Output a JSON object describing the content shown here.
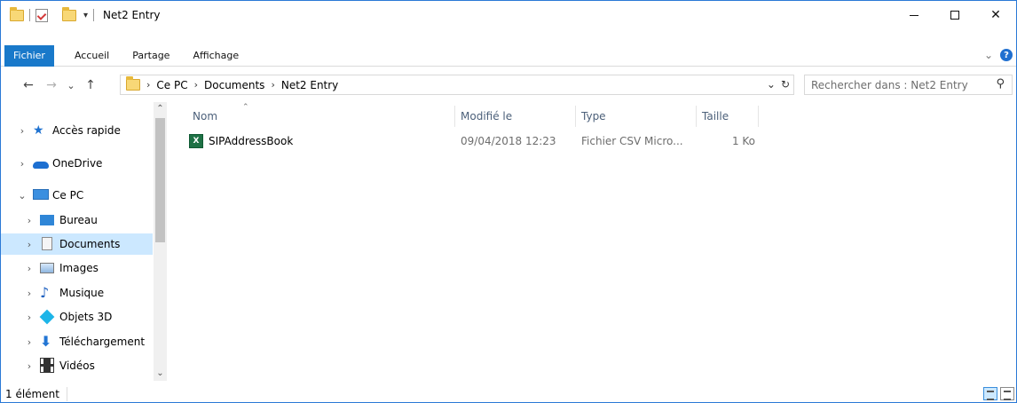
{
  "window": {
    "title": "Net2 Entry"
  },
  "ribbon": {
    "tabs": [
      "Fichier",
      "Accueil",
      "Partage",
      "Affichage"
    ],
    "help": "?"
  },
  "nav": {
    "back_icon": "←",
    "forward_icon": "→",
    "recent_icon": "⌄",
    "up_icon": "↑",
    "breadcrumb": [
      "Ce PC",
      "Documents",
      "Net2 Entry"
    ]
  },
  "search": {
    "placeholder": "Rechercher dans : Net2 Entry"
  },
  "sidebar": {
    "items": [
      {
        "label": "Accès rapide",
        "icon": "star-icon"
      },
      {
        "label": "OneDrive",
        "icon": "cloud-icon"
      },
      {
        "label": "Ce PC",
        "icon": "computer-icon"
      },
      {
        "label": "Bureau",
        "icon": "desktop-icon"
      },
      {
        "label": "Documents",
        "icon": "document-icon"
      },
      {
        "label": "Images",
        "icon": "pictures-icon"
      },
      {
        "label": "Musique",
        "icon": "music-icon"
      },
      {
        "label": "Objets 3D",
        "icon": "cube-icon"
      },
      {
        "label": "Téléchargement",
        "icon": "download-icon"
      },
      {
        "label": "Vidéos",
        "icon": "video-icon"
      }
    ],
    "selected": "Documents"
  },
  "columns": [
    "Nom",
    "Modifié le",
    "Type",
    "Taille"
  ],
  "files": [
    {
      "name": "SIPAddressBook",
      "modified": "09/04/2018 12:23",
      "type": "Fichier CSV Micro...",
      "size": "1 Ko"
    }
  ],
  "status": {
    "count": "1 élément"
  },
  "colors": {
    "accent": "#1979ca",
    "selection": "#cce8ff"
  }
}
